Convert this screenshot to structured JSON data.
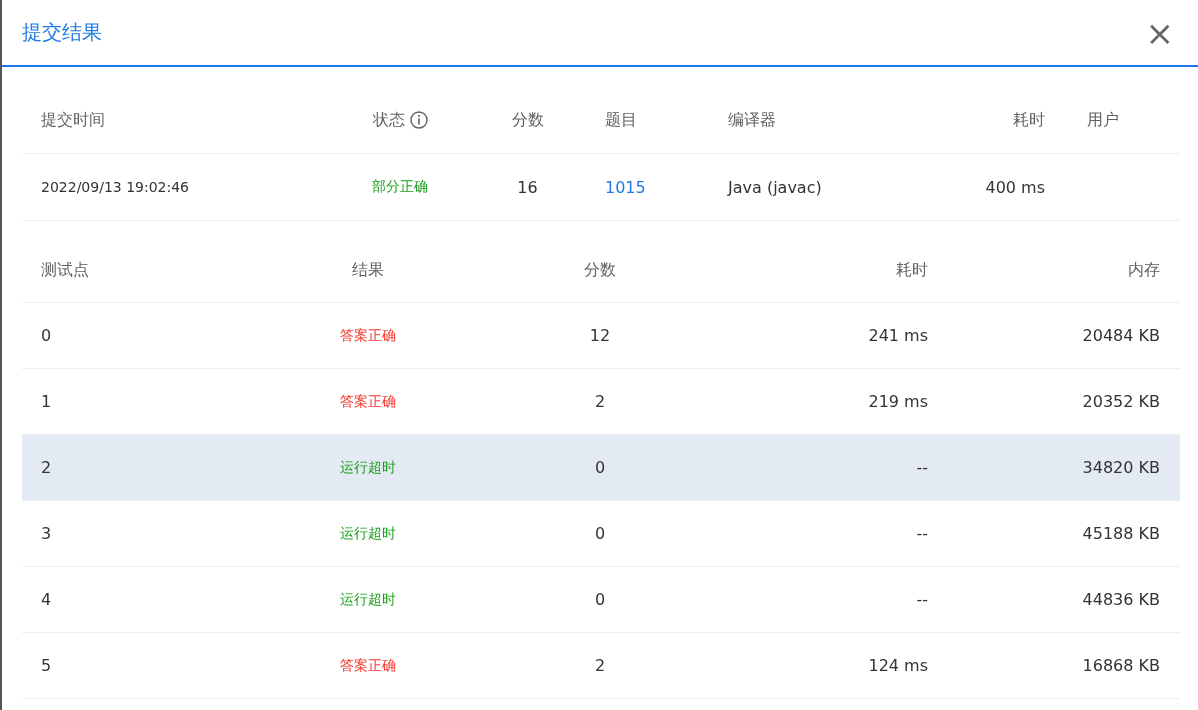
{
  "dialog": {
    "title": "提交结果",
    "close": "×"
  },
  "submission": {
    "columns": [
      "提交时间",
      "状态",
      "分数",
      "题目",
      "编译器",
      "耗时",
      "用户"
    ],
    "row": {
      "time": "2022/09/13 19:02:46",
      "status": "部分正确",
      "color": "#1a9e1a",
      "score": "16",
      "problem": "1015",
      "compiler": "Java (javac)",
      "duration": "400 ms"
    }
  },
  "testcases": {
    "columns": [
      "测试点",
      "结果",
      "分数",
      "耗时",
      "内存"
    ],
    "rows": [
      {
        "id": "0",
        "result": "答案正确",
        "color": "#f5362e",
        "score": "12",
        "time": "241 ms",
        "memory": "20484 KB",
        "hovered": false
      },
      {
        "id": "1",
        "result": "答案正确",
        "color": "#f5362e",
        "score": "2",
        "time": "219 ms",
        "memory": "20352 KB",
        "hovered": false
      },
      {
        "id": "2",
        "result": "运行超时",
        "color": "#1a9e1a",
        "score": "0",
        "time": "--",
        "memory": "34820 KB",
        "hovered": true
      },
      {
        "id": "3",
        "result": "运行超时",
        "color": "#1a9e1a",
        "score": "0",
        "time": "--",
        "memory": "45188 KB",
        "hovered": false
      },
      {
        "id": "4",
        "result": "运行超时",
        "color": "#1a9e1a",
        "score": "0",
        "time": "--",
        "memory": "44836 KB",
        "hovered": false
      },
      {
        "id": "5",
        "result": "答案正确",
        "color": "#f5362e",
        "score": "2",
        "time": "124 ms",
        "memory": "16868 KB",
        "hovered": false
      }
    ]
  }
}
